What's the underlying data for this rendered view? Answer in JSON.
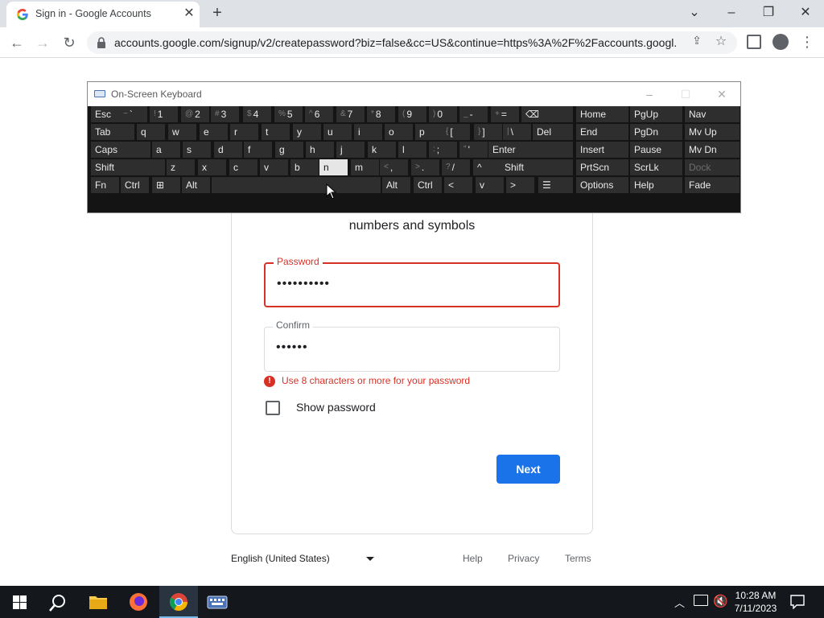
{
  "browser": {
    "tab_title": "Sign in - Google Accounts",
    "url": "accounts.google.com/signup/v2/createpassword?biz=false&cc=US&continue=https%3A%2F%2Faccounts.googl..."
  },
  "page": {
    "subtitle": "numbers and symbols",
    "password": {
      "label": "Password",
      "value": "••••••••••"
    },
    "confirm": {
      "label": "Confirm",
      "value": "••••••"
    },
    "error": "Use 8 characters or more for your password",
    "show_password": "Show password",
    "next": "Next"
  },
  "footer": {
    "language": "English (United States)",
    "links": [
      "Help",
      "Privacy",
      "Terms"
    ]
  },
  "osk": {
    "title": "On-Screen Keyboard",
    "rows": [
      [
        {
          "label": "Esc"
        },
        {
          "sec": "~",
          "label": "`"
        },
        {
          "sec": "!",
          "label": "1"
        },
        {
          "sec": "@",
          "label": "2"
        },
        {
          "sec": "#",
          "label": "3"
        },
        {
          "sec": "$",
          "label": "4"
        },
        {
          "sec": "%",
          "label": "5"
        },
        {
          "sec": "^",
          "label": "6"
        },
        {
          "sec": "&",
          "label": "7"
        },
        {
          "sec": "*",
          "label": "8"
        },
        {
          "sec": "(",
          "label": "9"
        },
        {
          "sec": ")",
          "label": "0"
        },
        {
          "sec": "_",
          "label": "-"
        },
        {
          "sec": "+",
          "label": "="
        },
        {
          "label": "⌫"
        },
        {
          "label": "Home"
        },
        {
          "label": "PgUp"
        },
        {
          "label": "Nav"
        }
      ],
      [
        {
          "label": "Tab"
        },
        {
          "label": "q"
        },
        {
          "label": "w"
        },
        {
          "label": "e"
        },
        {
          "label": "r"
        },
        {
          "label": "t"
        },
        {
          "label": "y"
        },
        {
          "label": "u"
        },
        {
          "label": "i"
        },
        {
          "label": "o"
        },
        {
          "label": "p"
        },
        {
          "sec": "{",
          "label": "["
        },
        {
          "sec": "}",
          "label": "]"
        },
        {
          "sec": "|",
          "label": "\\"
        },
        {
          "label": "Del"
        },
        {
          "label": "End"
        },
        {
          "label": "PgDn"
        },
        {
          "label": "Mv Up"
        }
      ],
      [
        {
          "label": "Caps"
        },
        {
          "label": "a"
        },
        {
          "label": "s"
        },
        {
          "label": "d"
        },
        {
          "label": "f"
        },
        {
          "label": "g"
        },
        {
          "label": "h"
        },
        {
          "label": "j"
        },
        {
          "label": "k"
        },
        {
          "label": "l"
        },
        {
          "sec": ":",
          "label": ";"
        },
        {
          "sec": "\"",
          "label": "'"
        },
        {
          "label": "Enter"
        },
        {
          "label": "Insert"
        },
        {
          "label": "Pause"
        },
        {
          "label": "Mv Dn"
        }
      ],
      [
        {
          "label": "Shift"
        },
        {
          "label": "z"
        },
        {
          "label": "x"
        },
        {
          "label": "c"
        },
        {
          "label": "v"
        },
        {
          "label": "b"
        },
        {
          "label": "n"
        },
        {
          "label": "m"
        },
        {
          "sec": "<",
          "label": ","
        },
        {
          "sec": ">",
          "label": "."
        },
        {
          "sec": "?",
          "label": "/"
        },
        {
          "label": "^"
        },
        {
          "label": "Shift"
        },
        {
          "label": "PrtScn"
        },
        {
          "label": "ScrLk"
        },
        {
          "label": "Dock"
        }
      ],
      [
        {
          "label": "Fn"
        },
        {
          "label": "Ctrl"
        },
        {
          "label": "⊞"
        },
        {
          "label": "Alt"
        },
        {
          "label": ""
        },
        {
          "label": "Alt"
        },
        {
          "label": "Ctrl"
        },
        {
          "label": "<"
        },
        {
          "label": "v"
        },
        {
          "label": ">"
        },
        {
          "label": "☰"
        },
        {
          "label": "Options"
        },
        {
          "label": "Help"
        },
        {
          "label": "Fade"
        }
      ]
    ],
    "pressed_key": "n",
    "dim_key": "Dock"
  },
  "taskbar": {
    "time": "10:28 AM",
    "date": "7/11/2023"
  },
  "colors": {
    "accent": "#1a73e8",
    "error": "#d93025",
    "osk_bg": "#141414",
    "osk_key": "#2e2e2e"
  }
}
